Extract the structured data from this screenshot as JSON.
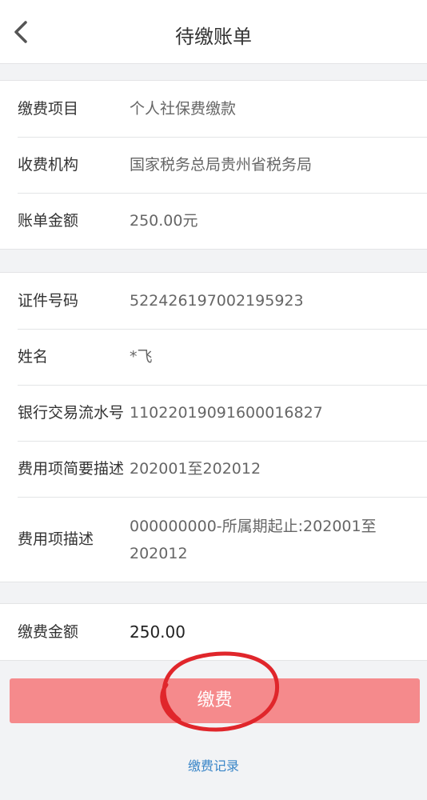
{
  "header": {
    "title": "待缴账单"
  },
  "bill": {
    "rows": [
      {
        "label": "缴费项目",
        "value": "个人社保费缴款"
      },
      {
        "label": "收费机构",
        "value": "国家税务总局贵州省税务局"
      },
      {
        "label": "账单金额",
        "value": "250.00元"
      }
    ]
  },
  "detail": {
    "rows": [
      {
        "label": "证件号码",
        "value": "522426197002195923"
      },
      {
        "label": "姓名",
        "value": "*飞"
      },
      {
        "label": "银行交易流水号",
        "value": "11022019091600016827"
      },
      {
        "label": "费用项简要描述",
        "value": "202001至202012"
      },
      {
        "label": "费用项描述",
        "value": "000000000-所属期起止:202001至202012"
      }
    ]
  },
  "payment": {
    "label": "缴费金额",
    "value": "250.00"
  },
  "actions": {
    "pay_label": "缴费",
    "record_label": "缴费记录"
  },
  "colors": {
    "pay_button": "#f58a8c",
    "link": "#3a86c8",
    "annotation": "#e0262b"
  }
}
